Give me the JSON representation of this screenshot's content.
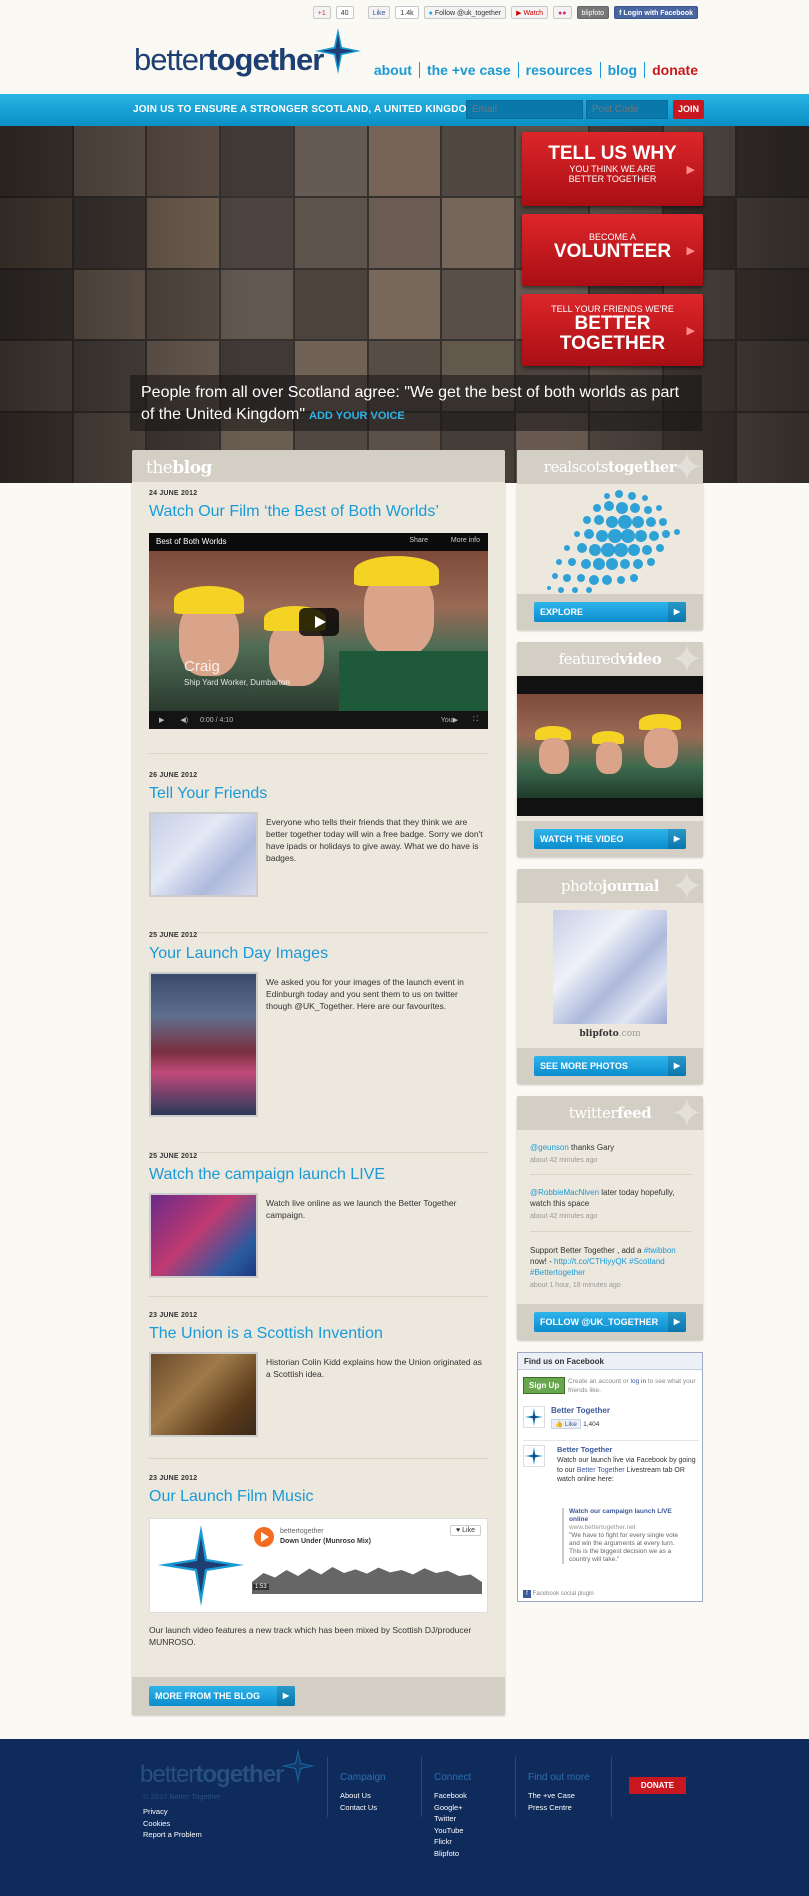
{
  "social": {
    "gplus_label": "+1",
    "gplus_count": "40",
    "fb_like_label": "Like",
    "fb_like_count": "1.4k",
    "twitter_follow_label": "Follow @uk_together",
    "youtube_label": "Watch",
    "flickr_label": "●●",
    "blipfoto_label": "blipfoto",
    "fb_login_label": "Login with Facebook"
  },
  "header": {
    "logo_better": "better",
    "logo_together": "together",
    "nav": [
      "about",
      "the +ve case",
      "resources",
      "blog",
      "donate"
    ]
  },
  "joinbar": {
    "text": "JOIN US TO ENSURE A STRONGER SCOTLAND, A UNITED KINGDOM:",
    "email_placeholder": "Email",
    "postcode_placeholder": "Post Code",
    "join_label": "JOIN"
  },
  "hero": {
    "cta1_big": "TELL US WHY",
    "cta1_small1": "YOU THINK WE ARE",
    "cta1_small2": "BETTER TOGETHER",
    "cta2_small": "BECOME A",
    "cta2_big": "VOLUNTEER",
    "cta3_small": "TELL YOUR FRIENDS WE'RE",
    "cta3_big1": "BETTER",
    "cta3_big2": "TOGETHER",
    "quote": "People from all over Scotland agree: \"We get the best of both worlds as part of the United Kingdom\"",
    "add_voice": "ADD YOUR VOICE"
  },
  "blog": {
    "head_the": "the",
    "head_blog": "blog",
    "posts": [
      {
        "date": "24 JUNE 2012",
        "title": "Watch Our Film ‘the Best of Both Worlds’"
      },
      {
        "date": "26 JUNE 2012",
        "title": "Tell Your Friends",
        "text": "Everyone who tells their friends that they think we are better together today will win a free badge. Sorry we don't have ipads or holidays to give away. What we do have is badges."
      },
      {
        "date": "25 JUNE 2012",
        "title": "Your Launch Day Images",
        "text": "We asked you for your images of the launch event in Edinburgh today and you sent them to us on twitter though @UK_Together. Here are our favourites."
      },
      {
        "date": "25 JUNE 2012",
        "title": "Watch the campaign launch LIVE",
        "text": "Watch live online as we launch the Better Together campaign."
      },
      {
        "date": "23 JUNE 2012",
        "title": "The Union is a Scottish Invention",
        "text": "Historian Colin Kidd explains how the Union originated as a Scottish idea."
      },
      {
        "date": "23 JUNE 2012",
        "title": "Our Launch Film Music",
        "text": "Our launch video features a new track which has been mixed by Scottish DJ/producer MUNROSO."
      }
    ],
    "video": {
      "title": "Best of Both Worlds",
      "share": "Share",
      "more": "More info",
      "caption_name": "Craig",
      "caption_role": "Ship Yard Worker, Dumbarton",
      "time": "0:00 / 4:10"
    },
    "soundcloud": {
      "user": "bettertogether",
      "track": "Down Under (Munroso Mix)",
      "like": "♥ Like",
      "time": "1:53"
    },
    "more_button": "MORE FROM THE BLOG"
  },
  "sidebar": {
    "realscots_a": "realscots",
    "realscots_b": "together",
    "explore": "EXPLORE",
    "featured_a": "featured",
    "featured_b": "video",
    "watch": "WATCH THE VIDEO",
    "photo_a": "photo",
    "photo_b": "journal",
    "blipfoto": "blipfoto",
    "blipfoto_com": ".com",
    "see_more": "SEE MORE PHOTOS",
    "twitter_a": "twitter",
    "twitter_b": "feed",
    "tweets": [
      {
        "user": "@geunson",
        "text": " thanks Gary",
        "time": "about 42 minutes ago"
      },
      {
        "user": "@RobbieMacNiven",
        "text": " later today hopefully, watch this space",
        "time": "about 42 minutes ago"
      },
      {
        "text": "Support Better Together , add a ",
        "tag1": "#twibbon",
        "mid": " now! - ",
        "link": "http://t.co/CTHiyyQK",
        "tag2": "#Scotland",
        "tag3": "#Bettertogether",
        "time": "about 1 hour, 18 minutes ago"
      }
    ],
    "follow": "FOLLOW @UK_TOGETHER"
  },
  "facebook": {
    "header": "Find us on Facebook",
    "signup": "Sign Up",
    "signup_text_a": "Create an account or ",
    "signup_text_login": "log in",
    "signup_text_b": " to see what your friends like.",
    "page_name": "Better Together",
    "like": "Like",
    "like_count": "1,404",
    "post_author": "Better Together",
    "post_text_a": "Watch our launch live via Facebook by going to our ",
    "post_link": "Better Together",
    "post_text_b": " Livestream tab OR watch online here:",
    "share_title": "Watch our campaign launch LIVE online",
    "share_url": "www.bettertogether.net",
    "share_desc": "\"We have to fight for every single vote and win the arguments at every turn. This is the biggest decision we as a country will take.\"",
    "plugin": "Facebook social plugin"
  },
  "footer": {
    "logo_better": "better",
    "logo_together": "together",
    "copyright": "© 2012 Better Together",
    "misc": [
      "Privacy",
      "Cookies",
      "Report a Problem"
    ],
    "campaign_head": "Campaign",
    "campaign": [
      "About Us",
      "Contact Us"
    ],
    "connect_head": "Connect",
    "connect": [
      "Facebook",
      "Google+",
      "Twitter",
      "YouTube",
      "Flickr",
      "Blipfoto"
    ],
    "findout_head": "Find out more",
    "findout": [
      "The +ve Case",
      "Press Centre"
    ],
    "donate": "DONATE"
  },
  "colors": {
    "accent_blue": "#1a9ad6",
    "brand_navy": "#1d3f73",
    "cta_red": "#c8171e",
    "footer_navy": "#0e2b5b"
  }
}
